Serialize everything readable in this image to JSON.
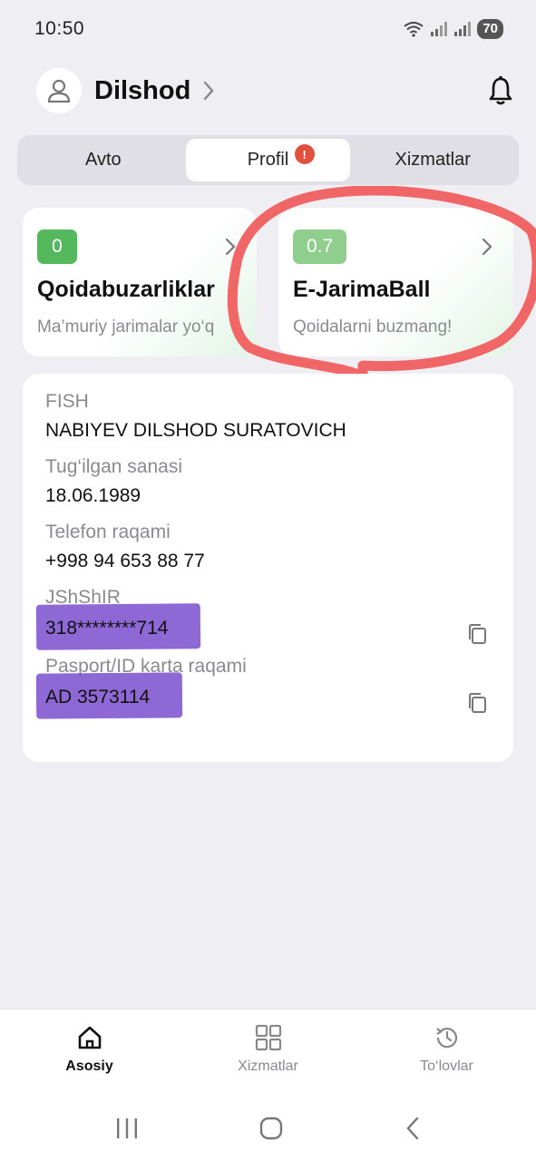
{
  "status_bar": {
    "time": "10:50",
    "battery": "70"
  },
  "header": {
    "user_name": "Dilshod"
  },
  "tabs": [
    {
      "label": "Avto",
      "active": false
    },
    {
      "label": "Profil",
      "active": true,
      "badge": "!"
    },
    {
      "label": "Xizmatlar",
      "active": false
    }
  ],
  "stats": {
    "violations": {
      "value": "0",
      "title": "Qoidabuzarliklar",
      "subtitle": "Ma’muriy jarimalar yo‘q"
    },
    "score": {
      "value": "0.7",
      "title": "E-JarimaBall",
      "subtitle": "Qoidalarni buzmang!"
    }
  },
  "profile": {
    "fish_label": "FISH",
    "fish_value": "NABIYEV DILSHOD SURATOVICH",
    "birth_label": "Tug‘ilgan sanasi",
    "birth_value": "18.06.1989",
    "phone_label": "Telefon raqami",
    "phone_value": "+998 94 653 88 77",
    "pinfl_label": "JShShIR",
    "pinfl_value": "318********714",
    "passport_label": "Pasport/ID karta raqami",
    "passport_value": "AD 3573114"
  },
  "bottom_nav": [
    {
      "label": "Asosiy",
      "icon": "home-icon",
      "active": true
    },
    {
      "label": "Xizmatlar",
      "icon": "grid-icon",
      "active": false
    },
    {
      "label": "To‘lovlar",
      "icon": "history-icon",
      "active": false
    }
  ],
  "colors": {
    "accent_green": "#56b85c",
    "light_green": "#8fce8c",
    "badge_red": "#e0503c",
    "annotation_red": "#f05a5a",
    "redaction_purple": "#7a4fcf"
  }
}
